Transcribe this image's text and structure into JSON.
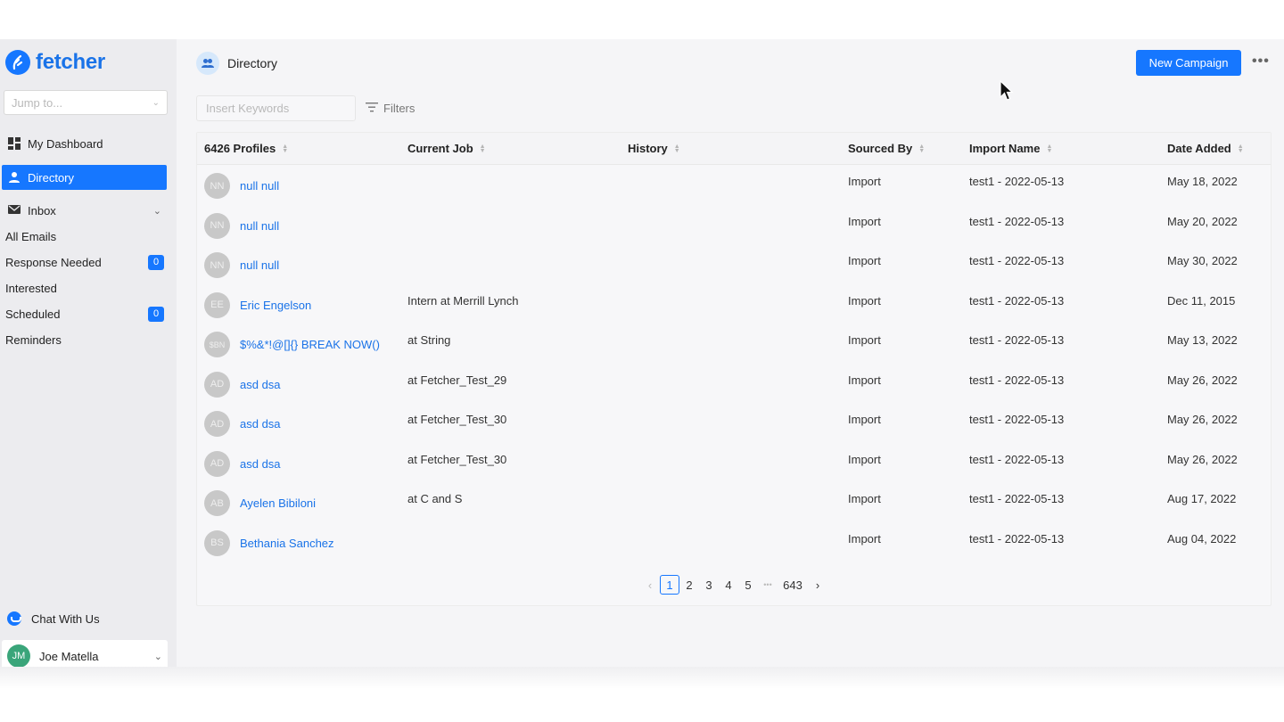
{
  "brand": {
    "name": "fetcher"
  },
  "sidebar": {
    "jump_placeholder": "Jump to...",
    "items": [
      {
        "label": "My Dashboard",
        "icon": "dashboard-icon"
      },
      {
        "label": "Directory",
        "icon": "person-icon",
        "active": true
      },
      {
        "label": "Inbox",
        "icon": "mail-icon"
      }
    ],
    "inbox_items": [
      {
        "label": "All Emails"
      },
      {
        "label": "Response Needed",
        "badge": "0"
      },
      {
        "label": "Interested"
      },
      {
        "label": "Scheduled",
        "badge": "0"
      },
      {
        "label": "Reminders"
      }
    ],
    "chat_label": "Chat With Us",
    "user": {
      "initials": "JM",
      "name": "Joe Matella"
    }
  },
  "header": {
    "title": "Directory",
    "new_campaign_label": "New Campaign",
    "more_label": "•••"
  },
  "toolbar": {
    "search_placeholder": "Insert Keywords",
    "filters_label": "Filters"
  },
  "table": {
    "columns": [
      "6426 Profiles",
      "Current Job",
      "History",
      "Sourced By",
      "Import Name",
      "Date Added"
    ],
    "rows": [
      {
        "initials": "NN",
        "name": "null null",
        "job": "",
        "history": "",
        "sourced": "Import",
        "import": "test1 - 2022-05-13",
        "date": "May 18, 2022"
      },
      {
        "initials": "NN",
        "name": "null null",
        "job": "",
        "history": "",
        "sourced": "Import",
        "import": "test1 - 2022-05-13",
        "date": "May 20, 2022"
      },
      {
        "initials": "NN",
        "name": "null null",
        "job": "",
        "history": "",
        "sourced": "Import",
        "import": "test1 - 2022-05-13",
        "date": "May 30, 2022"
      },
      {
        "initials": "EE",
        "name": "Eric Engelson",
        "job": "Intern at Merrill Lynch",
        "history": "",
        "sourced": "Import",
        "import": "test1 - 2022-05-13",
        "date": "Dec 11, 2015"
      },
      {
        "initials": "$BN",
        "name": "$%&*!@[]{} BREAK NOW()",
        "job": "at String",
        "history": "",
        "sourced": "Import",
        "import": "test1 - 2022-05-13",
        "date": "May 13, 2022"
      },
      {
        "initials": "AD",
        "name": "asd dsa",
        "job": "at Fetcher_Test_29",
        "history": "",
        "sourced": "Import",
        "import": "test1 - 2022-05-13",
        "date": "May 26, 2022"
      },
      {
        "initials": "AD",
        "name": "asd dsa",
        "job": "at Fetcher_Test_30",
        "history": "",
        "sourced": "Import",
        "import": "test1 - 2022-05-13",
        "date": "May 26, 2022"
      },
      {
        "initials": "AD",
        "name": "asd dsa",
        "job": "at Fetcher_Test_30",
        "history": "",
        "sourced": "Import",
        "import": "test1 - 2022-05-13",
        "date": "May 26, 2022"
      },
      {
        "initials": "AB",
        "name": "Ayelen Bibiloni",
        "job": "at C and S",
        "history": "",
        "sourced": "Import",
        "import": "test1 - 2022-05-13",
        "date": "Aug 17, 2022"
      },
      {
        "initials": "BS",
        "name": "Bethania Sanchez",
        "job": "",
        "history": "",
        "sourced": "Import",
        "import": "test1 - 2022-05-13",
        "date": "Aug 04, 2022"
      }
    ]
  },
  "pagination": {
    "prev": "‹",
    "pages": [
      "1",
      "2",
      "3",
      "4",
      "5"
    ],
    "current": "1",
    "ellipsis": "•••",
    "last": "643",
    "next": "›"
  },
  "colors": {
    "accent": "#1677ff",
    "link": "#1a73e8",
    "sidebar_bg": "#ececef"
  }
}
